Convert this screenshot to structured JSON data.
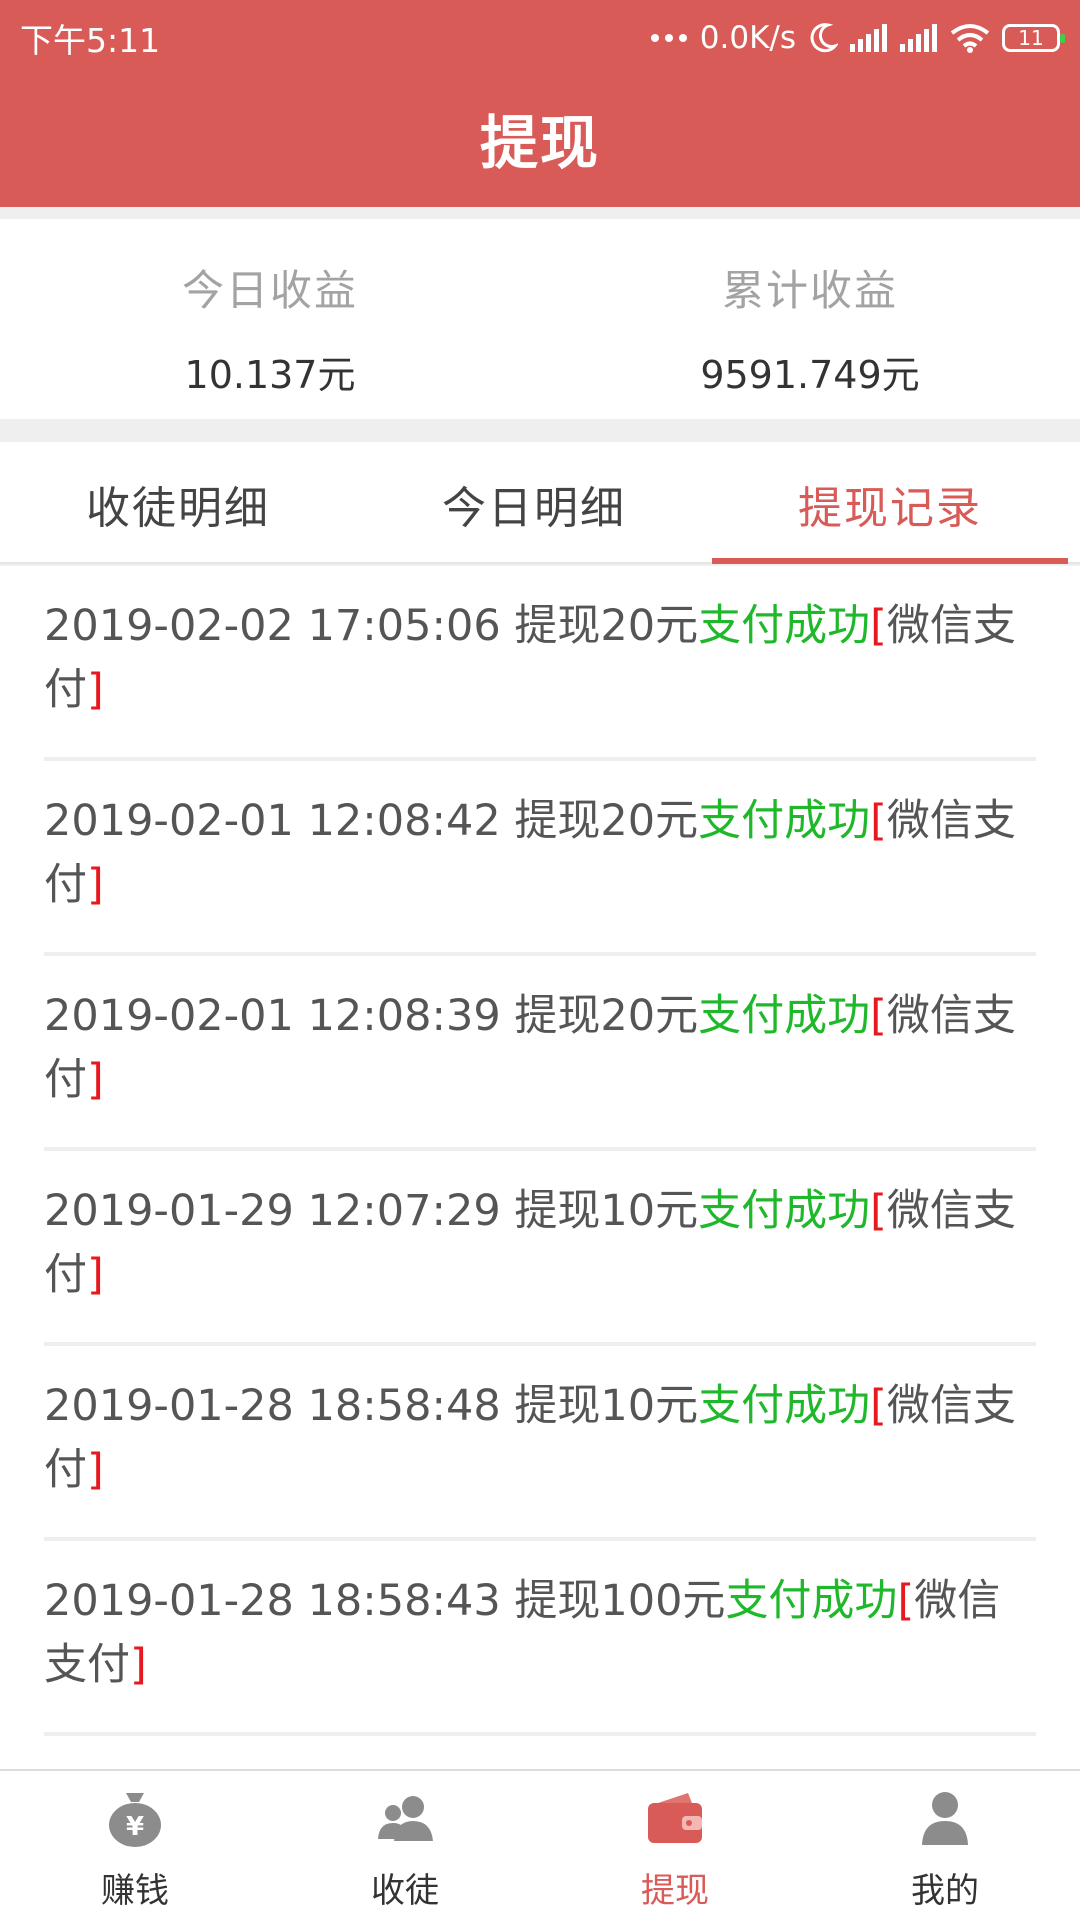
{
  "status_bar": {
    "time": "下午5:11",
    "speed": "0.0K/s",
    "battery": "11"
  },
  "header": {
    "title": "提现"
  },
  "stats": {
    "today_label": "今日收益",
    "today_value": "10.137元",
    "total_label": "累计收益",
    "total_value": "9591.749元"
  },
  "tabs": [
    {
      "label": "收徒明细",
      "active": false
    },
    {
      "label": "今日明细",
      "active": false
    },
    {
      "label": "提现记录",
      "active": true
    }
  ],
  "records": [
    {
      "text": "2019-02-02 17:05:06 提现20元",
      "status": "支付成功",
      "open": "[",
      "method": "微信支付",
      "close": "]"
    },
    {
      "text": "2019-02-01 12:08:42 提现20元",
      "status": "支付成功",
      "open": "[",
      "method": "微信支付",
      "close": "]"
    },
    {
      "text": "2019-02-01 12:08:39 提现20元",
      "status": "支付成功",
      "open": "[",
      "method": "微信支付",
      "close": "]"
    },
    {
      "text": "2019-01-29 12:07:29 提现10元",
      "status": "支付成功",
      "open": "[",
      "method": "微信支付",
      "close": "]"
    },
    {
      "text": "2019-01-28 18:58:48 提现10元",
      "status": "支付成功",
      "open": "[",
      "method": "微信支付",
      "close": "]"
    },
    {
      "text": "2019-01-28 18:58:43 提现100元",
      "status": "支付成功",
      "open": "[",
      "method": "微信支付",
      "close": "]"
    }
  ],
  "nav": [
    {
      "label": "赚钱",
      "icon": "money-bag-icon",
      "active": false
    },
    {
      "label": "收徒",
      "icon": "users-icon",
      "active": false
    },
    {
      "label": "提现",
      "icon": "wallet-icon",
      "active": true
    },
    {
      "label": "我的",
      "icon": "user-icon",
      "active": false
    }
  ],
  "colors": {
    "primary": "#d95b58",
    "success": "#1fb82a",
    "bracket": "#e8191e"
  }
}
